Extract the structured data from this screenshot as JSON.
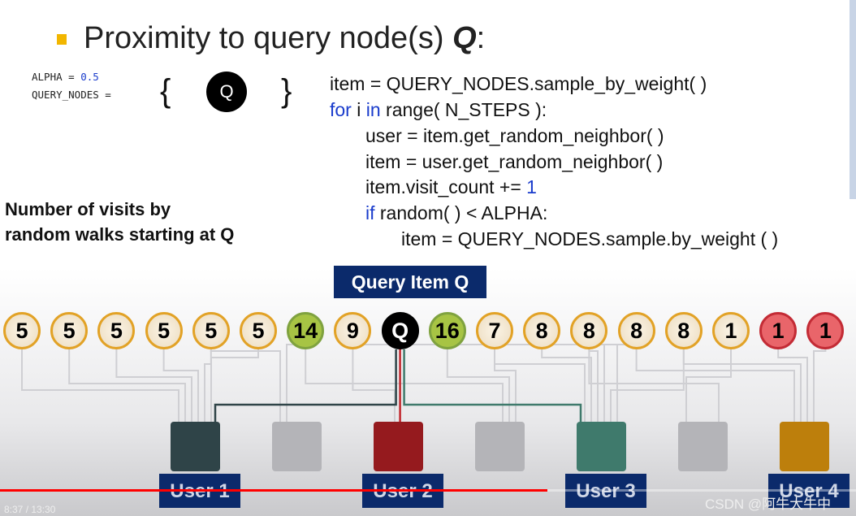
{
  "slide": {
    "title": "Proximity to query node(s) ",
    "title_q": "Q",
    "title_colon": ":",
    "alpha_label": "ALPHA = ",
    "alpha_value": "0.5",
    "query_nodes_label": "QUERY_NODES =",
    "brace_open": "{",
    "brace_close": "}",
    "query_symbol": "Q",
    "code": [
      {
        "pre": "item = QUERY_NODES.sample_by_weight( )"
      },
      {
        "kw": "for",
        "mid": " i ",
        "kw2": "in",
        "pre": " range( N_STEPS ):"
      },
      {
        "pre": "user = item.get_random_neighbor( )"
      },
      {
        "pre": "item = user.get_random_neighbor( )"
      },
      {
        "pre": "item.visit_count += ",
        "num": "1"
      },
      {
        "kw": "if",
        "pre": " random( ) < ALPHA:"
      },
      {
        "pre": "item = QUERY_NODES.sample.by_weight ( )"
      }
    ],
    "annotation": [
      "Number of visits by",
      "random walks starting at Q"
    ],
    "query_item_label": "Query Item Q",
    "items": [
      {
        "label": "5",
        "kind": "normal"
      },
      {
        "label": "5",
        "kind": "normal"
      },
      {
        "label": "5",
        "kind": "normal"
      },
      {
        "label": "5",
        "kind": "normal"
      },
      {
        "label": "5",
        "kind": "normal"
      },
      {
        "label": "5",
        "kind": "normal"
      },
      {
        "label": "14",
        "kind": "green"
      },
      {
        "label": "9",
        "kind": "normal"
      },
      {
        "label": "Q",
        "kind": "q"
      },
      {
        "label": "16",
        "kind": "green"
      },
      {
        "label": "7",
        "kind": "normal"
      },
      {
        "label": "8",
        "kind": "normal"
      },
      {
        "label": "8",
        "kind": "normal"
      },
      {
        "label": "8",
        "kind": "normal"
      },
      {
        "label": "8",
        "kind": "normal"
      },
      {
        "label": "1",
        "kind": "normal"
      },
      {
        "label": "1",
        "kind": "red"
      },
      {
        "label": "1",
        "kind": "red"
      }
    ],
    "users": [
      {
        "color": "#2f4448",
        "label": "User 1"
      },
      {
        "color": "#b4b4b8",
        "label": ""
      },
      {
        "color": "#951a1e",
        "label": "User 2"
      },
      {
        "color": "#b4b4b8",
        "label": ""
      },
      {
        "color": "#3f7a6c",
        "label": "User 3"
      },
      {
        "color": "#b4b4b8",
        "label": ""
      },
      {
        "color": "#bd7f0c",
        "label": "User 4"
      }
    ]
  },
  "player": {
    "time": "8:37 / 13:30",
    "progress": 0.639,
    "watermark": "CSDN @阿牛大牛中"
  }
}
